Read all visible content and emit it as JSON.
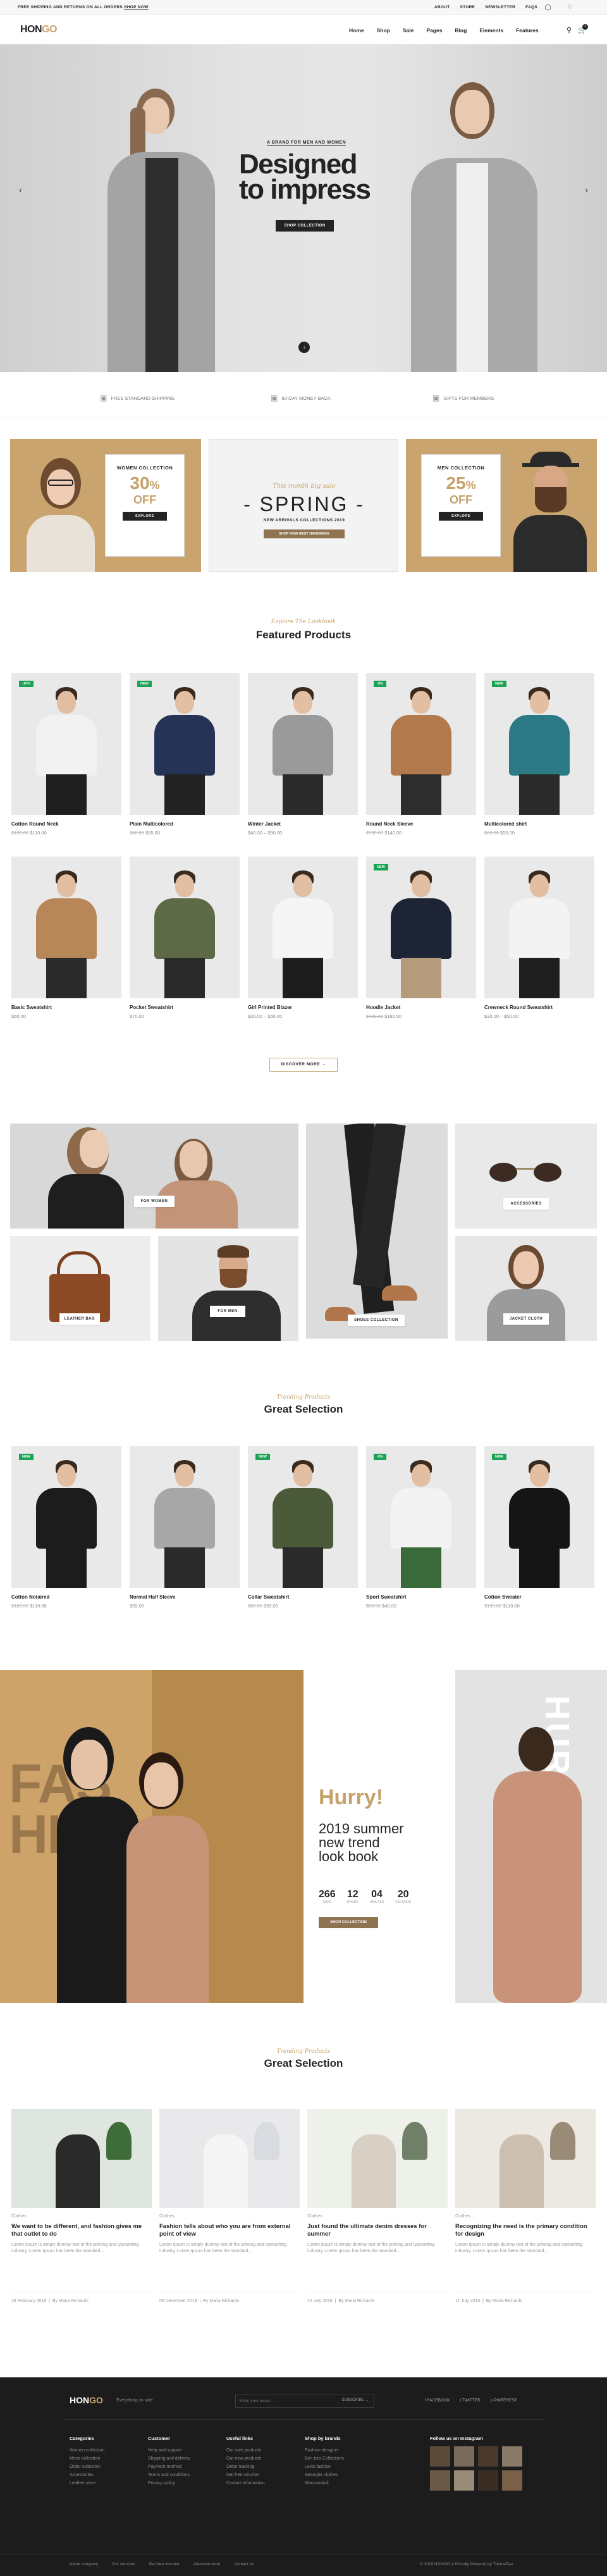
{
  "topbar": {
    "promo": "FREE SHIPPING AND RETURNS ON ALL ORDERS",
    "promo_link": "SHOP NOW",
    "links": [
      "ABOUT",
      "STORE",
      "NEWSLETTER",
      "FAQS"
    ]
  },
  "nav": {
    "logo_a": "HON",
    "logo_b": "GO",
    "menu": [
      "Home",
      "Shop",
      "Sale",
      "Pages",
      "Blog",
      "Elements",
      "Features"
    ],
    "cart_count": "1"
  },
  "hero": {
    "tag": "A BRAND FOR MEN AND WOMEN",
    "title": "Designed to impress",
    "button": "SHOP COLLECTION"
  },
  "features": [
    "FREE STANDARD SHIPPING",
    "60-DAY MONEY BACK",
    "GIFTS FOR MEMBERS"
  ],
  "promos": {
    "women": {
      "title": "WOMEN COLLECTION",
      "num": "30",
      "unit": "%",
      "off": "OFF",
      "button": "EXPLORE COLLECTION"
    },
    "spring": {
      "script": "This month big sale",
      "title": "SPRING",
      "sub": "NEW ARRIVALS COLLECTIONS 2019",
      "button": "SHOP NOW BEST HANDBAGS"
    },
    "men": {
      "title": "MEN COLLECTION",
      "num": "25",
      "unit": "%",
      "off": "OFF",
      "button": "EXPLORE COLLECTION"
    }
  },
  "featured": {
    "subtitle": "Explore The Lookbook",
    "title": "Featured Products",
    "button": "DISCOVER MORE",
    "products": [
      {
        "name": "Cotton Round Neck",
        "old": "$180.00",
        "price": "$110.00",
        "badge": "-10%"
      },
      {
        "name": "Plain Multicolored",
        "old": "$80.00",
        "price": "$55.00",
        "badge": "NEW"
      },
      {
        "name": "Winter Jacket",
        "old": "",
        "price": "$40.00 – $90.00",
        "badge": ""
      },
      {
        "name": "Round Neck Sleeve",
        "old": "$190.00",
        "price": "$140.00",
        "badge": "-5%"
      },
      {
        "name": "Multicolored shirt",
        "old": "$80.00",
        "price": "$55.00",
        "badge": "NEW"
      },
      {
        "name": "Basic Sweatshirt",
        "old": "",
        "price": "$50.00",
        "badge": ""
      },
      {
        "name": "Pocket Sweatshirt",
        "old": "",
        "price": "$70.00",
        "badge": ""
      },
      {
        "name": "Girl Printed Blazer",
        "old": "",
        "price": "$30.00 – $50.00",
        "badge": ""
      },
      {
        "name": "Hoodie Jacket",
        "old": "$480.00",
        "price": "$180.00",
        "badge": "NEW"
      },
      {
        "name": "Crewneck Round Sweatshirt",
        "old": "",
        "price": "$30.00 – $50.00",
        "badge": ""
      }
    ]
  },
  "lookbook": {
    "labels": [
      "FOR WOMEN",
      "SHOES COLLECTION",
      "ACCESSORIES",
      "LEATHER BAG",
      "FOR MEN",
      "JACKET CLOTH"
    ]
  },
  "trending": {
    "subtitle": "Trending Products",
    "title": "Great Selection",
    "products": [
      {
        "name": "Cotton Notaired",
        "old": "$180.00",
        "price": "$110.00",
        "badge": "NEW"
      },
      {
        "name": "Normal Half Sleeve",
        "old": "",
        "price": "$55.00",
        "badge": ""
      },
      {
        "name": "Collar Sweatshirt",
        "old": "$80.00",
        "price": "$55.00",
        "badge": "NEW"
      },
      {
        "name": "Sport Sweatshirt",
        "old": "$80.00",
        "price": "$40.00",
        "badge": "-5%"
      },
      {
        "name": "Cotton Sweater",
        "old": "$190.00",
        "price": "$110.00",
        "badge": "NEW"
      }
    ]
  },
  "hurry": {
    "bg_text": "FASHION",
    "title": "Hurry!",
    "sub": "2019 summer new trend look book",
    "counts": [
      {
        "n": "266",
        "l": "DAYS"
      },
      {
        "n": "12",
        "l": "HOURS"
      },
      {
        "n": "04",
        "l": "MINUTES"
      },
      {
        "n": "20",
        "l": "SECONDS"
      }
    ],
    "button": "SHOP COLLECTION",
    "vertical": "HURRY"
  },
  "blog": {
    "subtitle": "Trending Products",
    "title": "Great Selection",
    "posts": [
      {
        "cat": "Clothes",
        "title": "We want to be different, and fashion gives me that outlet to do",
        "excerpt": "Lorem Ipsum is simply dummy text of the printing and typesetting industry. Lorem Ipsum has been the standard...",
        "date": "28 February 2019",
        "author": "By Maria Richards"
      },
      {
        "cat": "Clothes",
        "title": "Fashion tells about who you are from external point of view",
        "excerpt": "Lorem Ipsum is simply dummy text of the printing and typesetting industry. Lorem Ipsum has been the standard...",
        "date": "09 December 2018",
        "author": "By Maria Richards"
      },
      {
        "cat": "Clothes",
        "title": "Just found the ultimate denim dresses for summer",
        "excerpt": "Lorem Ipsum is simply dummy text of the printing and typesetting industry. Lorem Ipsum has been the standard...",
        "date": "15 July 2018",
        "author": "By Maria Richards"
      },
      {
        "cat": "Clothes",
        "title": "Recognizing the need is the primary condition for design",
        "excerpt": "Lorem Ipsum is simply dummy text of the printing and typesetting industry. Lorem Ipsum has been the standard...",
        "date": "11 July 2018",
        "author": "By Maria Richards"
      }
    ]
  },
  "footer": {
    "logo_a": "HON",
    "logo_b": "GO",
    "tagline": "Everything on sale",
    "newsletter_placeholder": "Enter your email...",
    "subscribe": "SUBSCRIBE",
    "social": [
      "FACEBOOK",
      "TWITTER",
      "PINTEREST"
    ],
    "cols": [
      {
        "title": "Categories",
        "items": [
          "Women collection",
          "Mens collection",
          "Order collection",
          "Accessories",
          "Leather store"
        ]
      },
      {
        "title": "Customer",
        "items": [
          "Help and support",
          "Shipping and delivery",
          "Payment method",
          "Terms and conditions",
          "Privacy policy"
        ]
      },
      {
        "title": "Useful links",
        "items": [
          "Our sale products",
          "Our new products",
          "Order tracking",
          "Get free voucher",
          "Contact information"
        ]
      },
      {
        "title": "Shop by brands",
        "items": [
          "Fashion designer",
          "Ben bes Collections",
          "Levis fashion",
          "Wrangler clothes",
          "Moncomboli"
        ]
      }
    ],
    "insta_title": "Follow us on Instagram",
    "bottom_links": [
      "About company",
      "Our services",
      "Get free voucher",
      "Alternate store",
      "Contact us"
    ],
    "copyright": "© 2019 HONGO is Proudly Powered by ThemeZaa"
  },
  "colors": {
    "accent": "#c6a26b",
    "dark": "#232323",
    "badge": "#1aa354"
  }
}
